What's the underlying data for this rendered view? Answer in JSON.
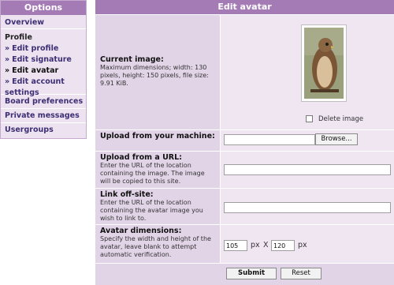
{
  "options": {
    "title": "Options",
    "overview": "Overview",
    "profile_heading": "Profile",
    "items": [
      {
        "bullet": "»",
        "label": "Edit profile"
      },
      {
        "bullet": "»",
        "label": "Edit signature"
      },
      {
        "bullet": "»",
        "label": "Edit avatar"
      },
      {
        "bullet": "»",
        "label": "Edit account settings"
      }
    ],
    "board_preferences": "Board preferences",
    "private_messages": "Private messages",
    "usergroups": "Usergroups"
  },
  "form": {
    "title": "Edit avatar",
    "current_image": {
      "title": "Current image:",
      "desc": "Maximum dimensions; width: 130 pixels, height: 150 pixels, file size: 9.91 KiB.",
      "delete_label": "Delete image"
    },
    "upload": {
      "title": "Upload from your machine:",
      "browse_label": "Browse...",
      "value": ""
    },
    "url": {
      "title": "Upload from a URL:",
      "desc": "Enter the URL of the location containing the image. The image will be copied to this site.",
      "value": ""
    },
    "offsite": {
      "title": "Link off-site:",
      "desc": "Enter the URL of the location containing the avatar image you wish to link to.",
      "value": ""
    },
    "dimensions": {
      "title": "Avatar dimensions:",
      "desc": "Specify the width and height of the avatar, leave blank to attempt automatic verification.",
      "width": "105",
      "height": "120",
      "px_label": "px",
      "x_label": "X"
    },
    "submit_label": "Submit",
    "reset_label": "Reset"
  },
  "colors": {
    "header_bg": "#a47bb5",
    "panel_bg": "#efe6f2",
    "label_bg": "#e2d4e7",
    "link": "#3e2f74"
  }
}
